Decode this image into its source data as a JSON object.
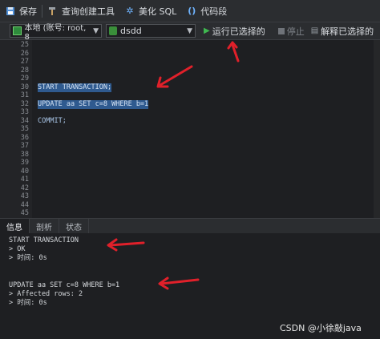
{
  "toolbar": {
    "save_label": "保存",
    "query_builder_label": "查询创建工具",
    "beautify_label": "美化 SQL",
    "snippet_label": "代码段"
  },
  "connbar": {
    "connection_value": "本地 (账号: root, 8",
    "database_value": "dsdd",
    "run_selected_label": "运行已选择的",
    "stop_label": "停止",
    "explain_selected_label": "解释已选择的"
  },
  "editor": {
    "lines": [
      {
        "num": "25",
        "code": ""
      },
      {
        "num": "26",
        "code": ""
      },
      {
        "num": "27",
        "code": ""
      },
      {
        "num": "28",
        "code": ""
      },
      {
        "num": "29",
        "code": ""
      },
      {
        "num": "30",
        "code": "START TRANSACTION;"
      },
      {
        "num": "31",
        "code": ""
      },
      {
        "num": "32",
        "code": "UPDATE aa SET c=8 WHERE b=1"
      },
      {
        "num": "33",
        "code": ""
      },
      {
        "num": "34",
        "code": "COMMIT;"
      },
      {
        "num": "35",
        "code": ""
      },
      {
        "num": "36",
        "code": ""
      },
      {
        "num": "37",
        "code": ""
      },
      {
        "num": "38",
        "code": ""
      },
      {
        "num": "39",
        "code": ""
      },
      {
        "num": "40",
        "code": ""
      },
      {
        "num": "41",
        "code": ""
      },
      {
        "num": "42",
        "code": ""
      },
      {
        "num": "43",
        "code": ""
      },
      {
        "num": "44",
        "code": ""
      },
      {
        "num": "45",
        "code": ""
      }
    ]
  },
  "result_tabs": [
    "信息",
    "剖析",
    "状态"
  ],
  "output": {
    "lines": [
      "START TRANSACTION",
      "> OK",
      "> 时间: 0s",
      "",
      "",
      "UPDATE aa SET c=8 WHERE b=1",
      "> Affected rows: 2",
      "> 时间: 0s"
    ]
  },
  "watermark": "CSDN @小徐敲java",
  "colors": {
    "arrow": "#e0202a",
    "selection": "#2f5a8f",
    "run_icon": "#3fb950"
  }
}
